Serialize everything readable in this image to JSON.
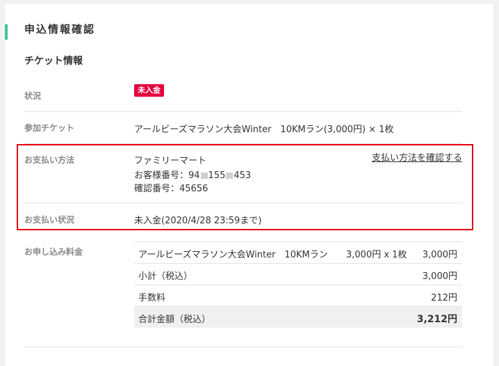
{
  "page": {
    "title": "申込情報確認",
    "section_title": "チケット情報"
  },
  "status": {
    "label": "状況",
    "badge": "未入金",
    "badge_color": "#e6003e"
  },
  "ticket": {
    "label": "参加チケット",
    "value": "アールビーズマラソン大会Winter　10KMラン(3,000円) × 1枚"
  },
  "payment": {
    "label": "お支払い方法",
    "method": "ファミリーマート",
    "customer_no_prefix": "お客様番号：94",
    "customer_no_mid": "155",
    "customer_no_suffix": "453",
    "confirm_no": "確認番号：45656",
    "link": "支払い方法を確認する",
    "highlight_color": "#e60012"
  },
  "payment_status": {
    "label": "お支払い状況",
    "value": "未入金(2020/4/28 23:59まで)"
  },
  "fee": {
    "label": "お申し込み料金",
    "rows": [
      {
        "name": "アールビーズマラソン大会Winter　10KMラン",
        "qty": "3,000円 x 1枚",
        "amount": "3,000円"
      },
      {
        "name": "小計（税込）",
        "qty": "",
        "amount": "3,000円"
      },
      {
        "name": "手数料",
        "qty": "",
        "amount": "212円"
      }
    ],
    "total": {
      "name": "合計金額（税込）",
      "amount": "3,212円"
    }
  },
  "accent_color": "#3cc49a"
}
